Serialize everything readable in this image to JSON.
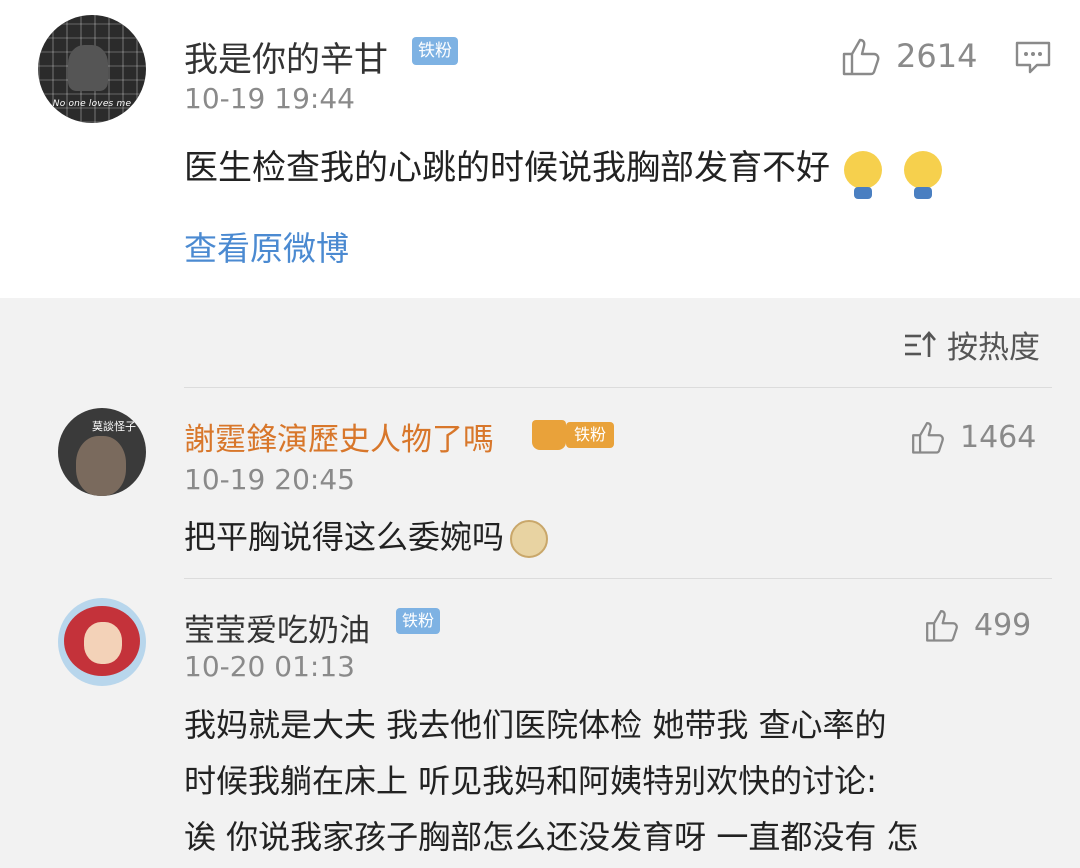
{
  "main_post": {
    "username": "我是你的辛甘",
    "badge": "铁粉",
    "time": "10-19 19:44",
    "text": "医生检查我的心跳的时候说我胸部发育不好",
    "likes": "2614",
    "view_original": "查看原微博",
    "avatar_caption": "No one loves me"
  },
  "sort": {
    "label": "按热度"
  },
  "comments": [
    {
      "username": "謝霆鋒演歷史人物了嗎",
      "badge": "铁粉",
      "time": "10-19 20:45",
      "text": "把平胸说得这么委婉吗",
      "likes": "1464",
      "avatar_tag": "莫談怪子"
    },
    {
      "username": "莹莹爱吃奶油",
      "badge": "铁粉",
      "time": "10-20 01:13",
      "lines": [
        "我妈就是大夫 我去他们医院体检 她带我  查心率的",
        "时候我躺在床上 听见我妈和阿姨特别欢快的讨论:",
        "诶 你说我家孩子胸部怎么还没发育呀 一直都没有 怎"
      ],
      "likes": "499"
    }
  ],
  "colors": {
    "link": "#4b8ad1",
    "username_highlight": "#d8772b",
    "badge_blue": "#7eb2e3",
    "badge_gold": "#e9a23a"
  }
}
